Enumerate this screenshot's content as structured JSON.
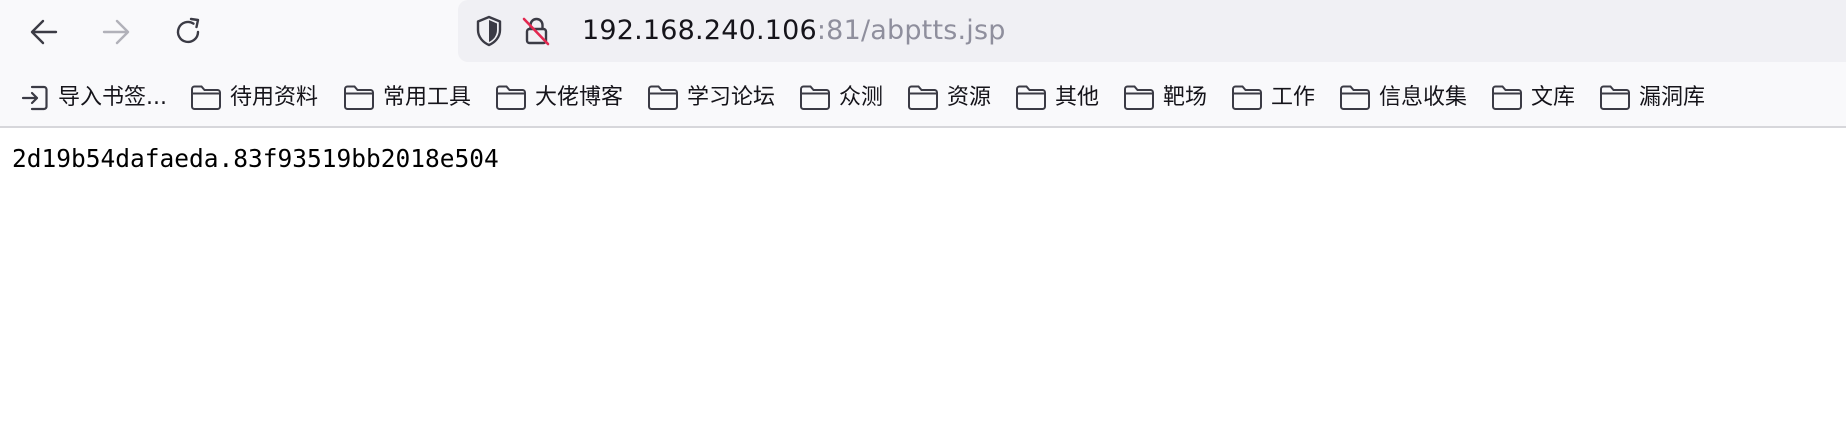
{
  "toolbar": {
    "back_icon": "arrow-left-icon",
    "forward_icon": "arrow-right-icon",
    "reload_icon": "reload-icon"
  },
  "urlbar": {
    "host": "192.168.240.106",
    "rest": ":81/abptts.jsp",
    "shield_icon": "shield-icon",
    "insecure_icon": "insecure-lock-icon"
  },
  "bookmarks": {
    "import_label": "导入书签...",
    "folders": [
      "待用资料",
      "常用工具",
      "大佬博客",
      "学习论坛",
      "众测",
      "资源",
      "其他",
      "靶场",
      "工作",
      "信息收集",
      "文库",
      "漏洞库"
    ]
  },
  "page": {
    "body_text": "2d19b54dafaeda.83f93519bb2018e504"
  },
  "colors": {
    "chrome_bg": "#f9f9fb",
    "urlbar_bg": "#f0f0f4",
    "text": "#15141a",
    "muted_text": "#8f8f9d",
    "disabled_icon": "#b1b1b9"
  }
}
